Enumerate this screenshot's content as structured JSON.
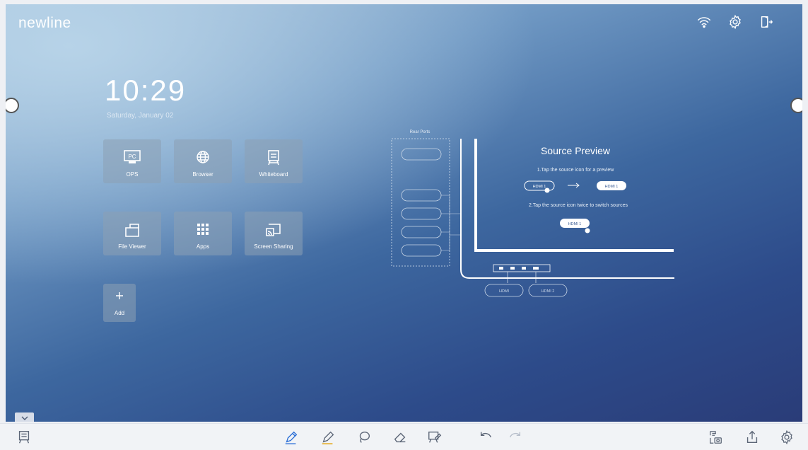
{
  "brand": "newline",
  "clock": {
    "time": "10:29",
    "date": "Saturday, January 02"
  },
  "apps": [
    {
      "label": "OPS",
      "icon": "pc-icon",
      "icon_text": "PC"
    },
    {
      "label": "Browser",
      "icon": "globe-icon"
    },
    {
      "label": "Whiteboard",
      "icon": "whiteboard-icon"
    },
    {
      "label": "File Viewer",
      "icon": "folder-icon"
    },
    {
      "label": "Apps",
      "icon": "grid-icon"
    },
    {
      "label": "Screen Sharing",
      "icon": "cast-icon"
    },
    {
      "label": "Add",
      "icon": "plus-icon"
    }
  ],
  "preview": {
    "ports_title": "Rear Ports",
    "title": "Source Preview",
    "step1": "1.Tap the source icon for a preview",
    "step2": "2.Tap the source icon twice to switch sources",
    "chip_a": "HDMI 1",
    "chip_b": "HDMI 1",
    "chip_c": "HDMI 1",
    "front_ports": [
      "HDMI",
      "HDMI 2"
    ]
  },
  "top_icons": [
    "wifi-icon",
    "gear-icon",
    "exit-icon"
  ],
  "toolbar_icons": [
    "whiteboard-icon",
    "pen-icon",
    "highlighter-icon",
    "lasso-icon",
    "eraser-icon",
    "annotate-icon",
    "undo-icon",
    "redo-icon",
    "screenshot-icon",
    "share-icon",
    "gear-icon"
  ],
  "colors": {
    "accent": "#2b6fd6",
    "highlighter": "#e6b33a"
  }
}
